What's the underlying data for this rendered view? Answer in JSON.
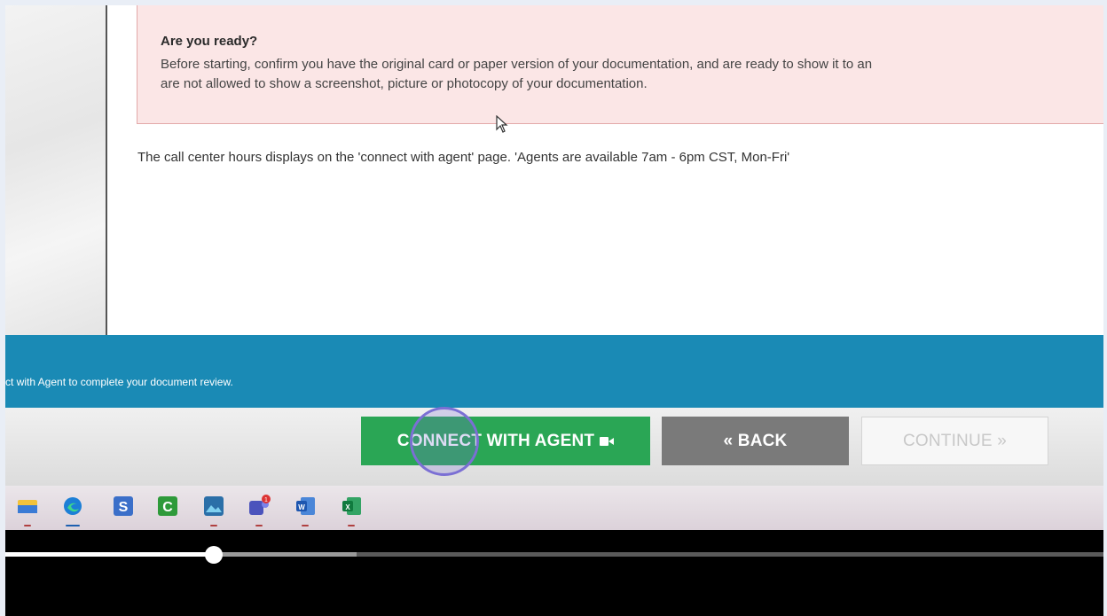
{
  "notice": {
    "title": "Are you ready?",
    "body": "Before starting, confirm you have the original card or paper version of your documentation, and are ready to show it to an\nare not allowed to show a screenshot, picture or photocopy of your documentation."
  },
  "hours_text": "The call center hours displays on the 'connect with agent' page. 'Agents are available 7am - 6pm CST, Mon-Fri'",
  "banner_text": "ct with Agent to complete your document review.",
  "buttons": {
    "connect": "CONNECT WITH AGENT",
    "back": "« BACK",
    "continue": "CONTINUE »"
  },
  "taskbar": {
    "icons": [
      "file-explorer-icon",
      "edge-icon",
      "s-app-icon",
      "c-app-icon",
      "photos-icon",
      "teams-icon",
      "word-icon",
      "excel-icon"
    ],
    "teams_badge": "1"
  },
  "video": {
    "progress": 0.19,
    "buffered": 0.32
  },
  "colors": {
    "banner": "#1a8ab5",
    "connect_button": "#2aa655",
    "back_button": "#7a7a7a",
    "notice_bg": "#fbe6e6"
  }
}
